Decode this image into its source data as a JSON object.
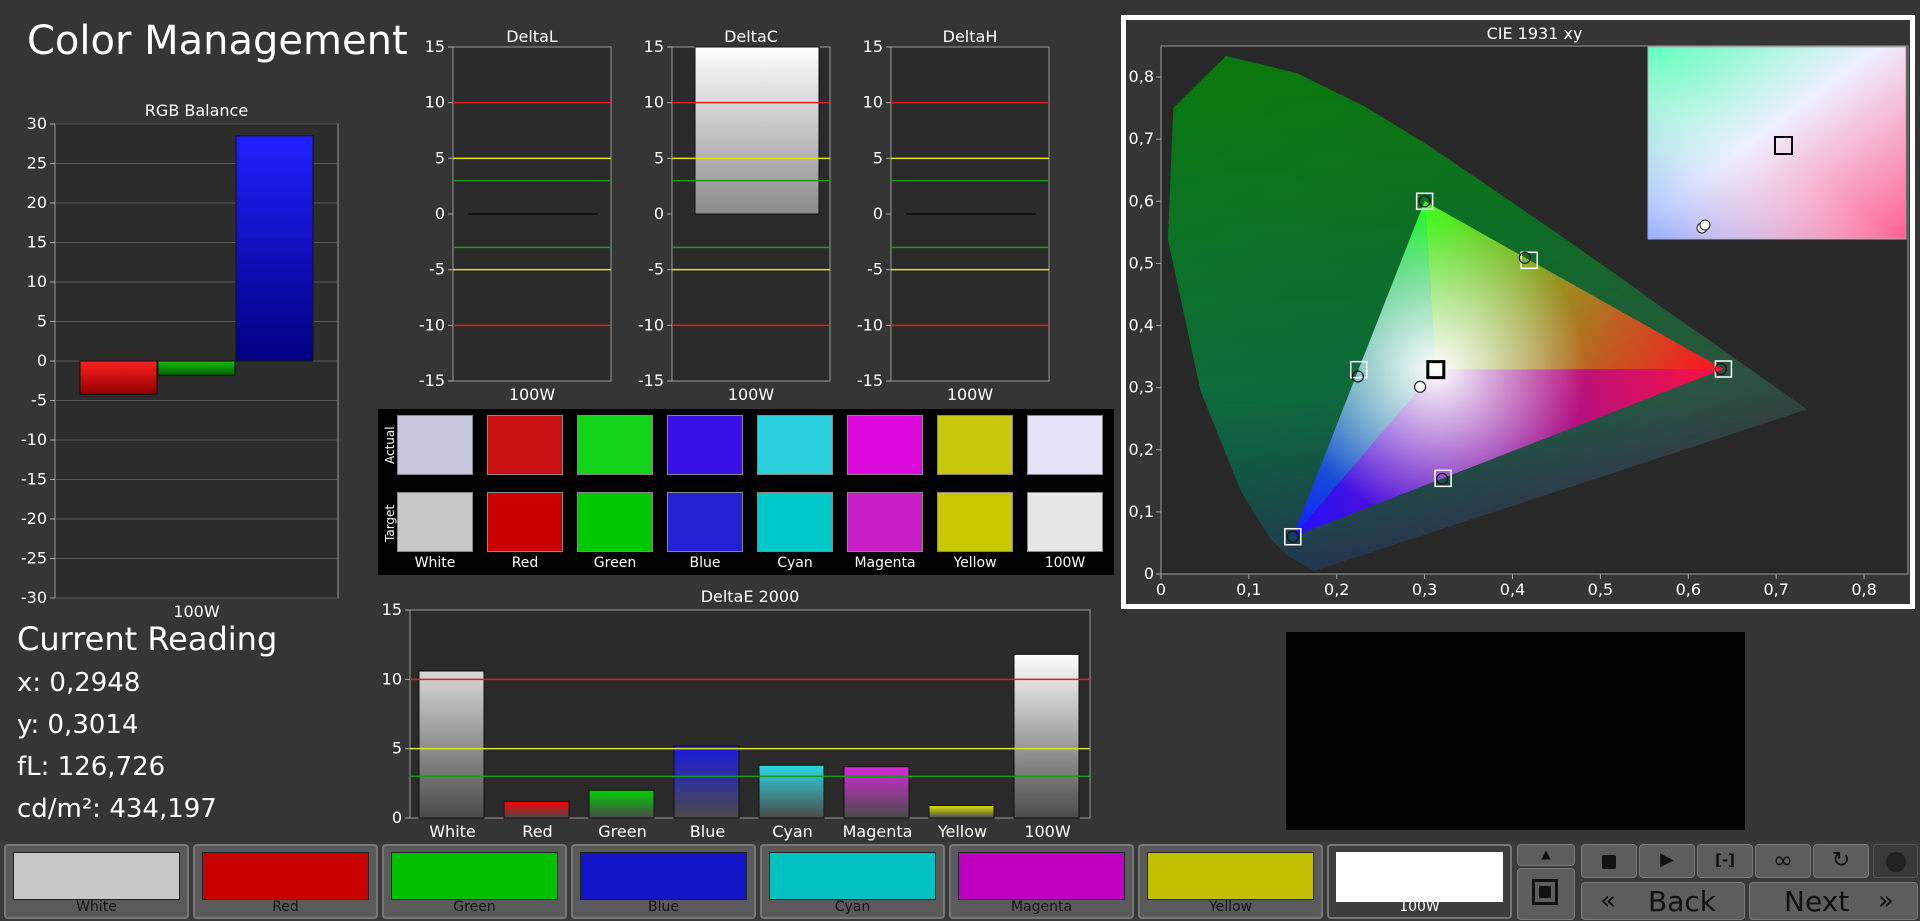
{
  "title": "Color Management",
  "rgb_balance": {
    "title": "RGB Balance",
    "xlabel": "100W",
    "y_ticks": [
      "30",
      "25",
      "20",
      "15",
      "10",
      "5",
      "0",
      "-5",
      "-10",
      "-15",
      "-20",
      "-25",
      "-30"
    ]
  },
  "delta_charts": {
    "y_ticks": [
      "15",
      "10",
      "5",
      "0",
      "-5",
      "-10",
      "-15"
    ],
    "items": [
      {
        "title": "DeltaL",
        "xlabel": "100W"
      },
      {
        "title": "DeltaC",
        "xlabel": "100W"
      },
      {
        "title": "DeltaH",
        "xlabel": "100W"
      }
    ]
  },
  "swatches": {
    "row_labels": [
      "Actual",
      "Target"
    ],
    "names": [
      "White",
      "Red",
      "Green",
      "Blue",
      "Cyan",
      "Magenta",
      "Yellow",
      "100W"
    ],
    "actual": [
      "#c6c6de",
      "#c81010",
      "#12d21a",
      "#3a10e8",
      "#2ad0dc",
      "#dc08dc",
      "#c8c80a",
      "#e4e4f8"
    ],
    "target": [
      "#c8c8c8",
      "#c80000",
      "#00c800",
      "#2222d0",
      "#00c8c8",
      "#c81ec8",
      "#c8c800",
      "#e6e6e6"
    ]
  },
  "current_reading": {
    "title": "Current Reading",
    "x": "x: 0,2948",
    "y": "y: 0,3014",
    "fl": "fL: 126,726",
    "cd": "cd/m²: 434,197"
  },
  "cie": {
    "title": "CIE 1931 xy",
    "x_ticks": [
      "0",
      "0,1",
      "0,2",
      "0,3",
      "0,4",
      "0,5",
      "0,6",
      "0,7",
      "0,8"
    ],
    "y_ticks": [
      "0",
      "0,1",
      "0,2",
      "0,3",
      "0,4",
      "0,5",
      "0,6",
      "0,7",
      "0,8"
    ]
  },
  "chart_data": [
    {
      "type": "bar",
      "title": "RGB Balance",
      "categories": [
        "100W"
      ],
      "series": [
        {
          "name": "Red",
          "values": [
            -4.2
          ],
          "color": "#ff0000"
        },
        {
          "name": "Green",
          "values": [
            -1.8
          ],
          "color": "#00b000"
        },
        {
          "name": "Blue",
          "values": [
            28.5
          ],
          "color": "#1010ff"
        }
      ],
      "ylim": [
        -30,
        30
      ],
      "xlabel": "100W"
    },
    {
      "type": "bar",
      "title": "DeltaL",
      "categories": [
        "100W"
      ],
      "values": [
        0
      ],
      "ylim": [
        -15,
        15
      ],
      "reference_lines": [
        10,
        5,
        3,
        -3,
        -5,
        -10
      ]
    },
    {
      "type": "bar",
      "title": "DeltaC",
      "categories": [
        "100W"
      ],
      "values": [
        15
      ],
      "ylim": [
        -15,
        15
      ],
      "reference_lines": [
        10,
        5,
        3,
        -3,
        -5,
        -10
      ]
    },
    {
      "type": "bar",
      "title": "DeltaH",
      "categories": [
        "100W"
      ],
      "values": [
        0
      ],
      "ylim": [
        -15,
        15
      ],
      "reference_lines": [
        10,
        5,
        3,
        -3,
        -5,
        -10
      ]
    },
    {
      "type": "bar",
      "title": "DeltaE 2000",
      "categories": [
        "White",
        "Red",
        "Green",
        "Blue",
        "Cyan",
        "Magenta",
        "Yellow",
        "100W"
      ],
      "values": [
        10.6,
        1.2,
        2.0,
        5.2,
        3.8,
        3.7,
        0.9,
        11.8
      ],
      "colors": [
        "#d8d8d8",
        "#ff0000",
        "#00d000",
        "#1a1ae0",
        "#2ad8e0",
        "#d828d8",
        "#e0e000",
        "#ffffff"
      ],
      "ylim": [
        0,
        15
      ],
      "y_ticks": [
        "0",
        "5",
        "10",
        "15"
      ],
      "reference_lines": [
        10,
        5,
        3
      ]
    },
    {
      "type": "scatter",
      "title": "CIE 1931 xy",
      "xlim": [
        0,
        0.85
      ],
      "ylim": [
        0,
        0.85
      ],
      "targets": [
        {
          "name": "Red",
          "x": 0.64,
          "y": 0.33
        },
        {
          "name": "Green",
          "x": 0.3,
          "y": 0.6
        },
        {
          "name": "Blue",
          "x": 0.15,
          "y": 0.06
        },
        {
          "name": "Cyan",
          "x": 0.225,
          "y": 0.329
        },
        {
          "name": "Magenta",
          "x": 0.321,
          "y": 0.154
        },
        {
          "name": "Yellow",
          "x": 0.419,
          "y": 0.505
        },
        {
          "name": "White",
          "x": 0.3127,
          "y": 0.329
        }
      ],
      "actuals": [
        {
          "name": "Red",
          "x": 0.637,
          "y": 0.33
        },
        {
          "name": "Green",
          "x": 0.3,
          "y": 0.6
        },
        {
          "name": "Blue",
          "x": 0.15,
          "y": 0.06
        },
        {
          "name": "Cyan",
          "x": 0.224,
          "y": 0.318
        },
        {
          "name": "Magenta",
          "x": 0.32,
          "y": 0.153
        },
        {
          "name": "Yellow",
          "x": 0.414,
          "y": 0.509
        },
        {
          "name": "100W",
          "x": 0.2948,
          "y": 0.3014
        }
      ]
    }
  ],
  "deltae": {
    "title": "DeltaE 2000"
  },
  "patch_buttons": [
    {
      "label": "White",
      "color": "#c8c8c8"
    },
    {
      "label": "Red",
      "color": "#c80000"
    },
    {
      "label": "Green",
      "color": "#00c000"
    },
    {
      "label": "Blue",
      "color": "#1414c8"
    },
    {
      "label": "Cyan",
      "color": "#00c0c0"
    },
    {
      "label": "Magenta",
      "color": "#c000c0"
    },
    {
      "label": "Yellow",
      "color": "#c0c000"
    },
    {
      "label": "100W",
      "color": "#ffffff"
    }
  ],
  "nav": {
    "back": "Back",
    "next": "Next"
  },
  "icons": [
    "scroll-up-icon",
    "stop-icon",
    "play-icon",
    "bracket-icon",
    "loop-icon",
    "refresh-icon",
    "back-chevron-icon",
    "next-chevron-icon",
    "record-icon"
  ]
}
